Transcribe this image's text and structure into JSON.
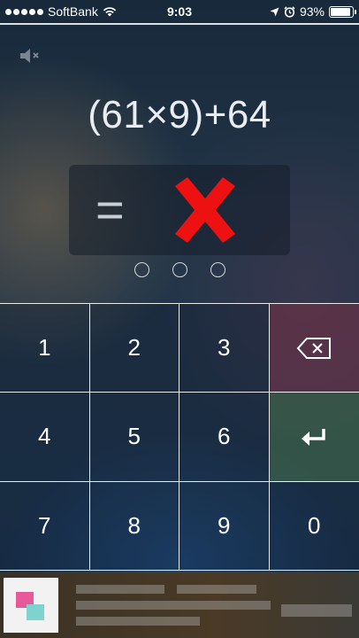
{
  "status_bar": {
    "carrier": "SoftBank",
    "time": "9:03",
    "battery": "93%",
    "battery_level": 0.93,
    "signal_dots": 5
  },
  "game": {
    "mute_icon": "speaker-muted-icon",
    "problem": "(61×9)+64",
    "equals_sign": "=",
    "answer_state_icon": "red-x-icon",
    "progress_dots": 3
  },
  "keypad": {
    "keys": [
      "1",
      "2",
      "3",
      "⌫",
      "4",
      "5",
      "6",
      "↵",
      "7",
      "8",
      "9",
      "0"
    ]
  },
  "colors": {
    "wrong_mark": "#ee1111",
    "backspace_key_bg": "#7a3246",
    "enter_key_bg": "#466e46"
  }
}
